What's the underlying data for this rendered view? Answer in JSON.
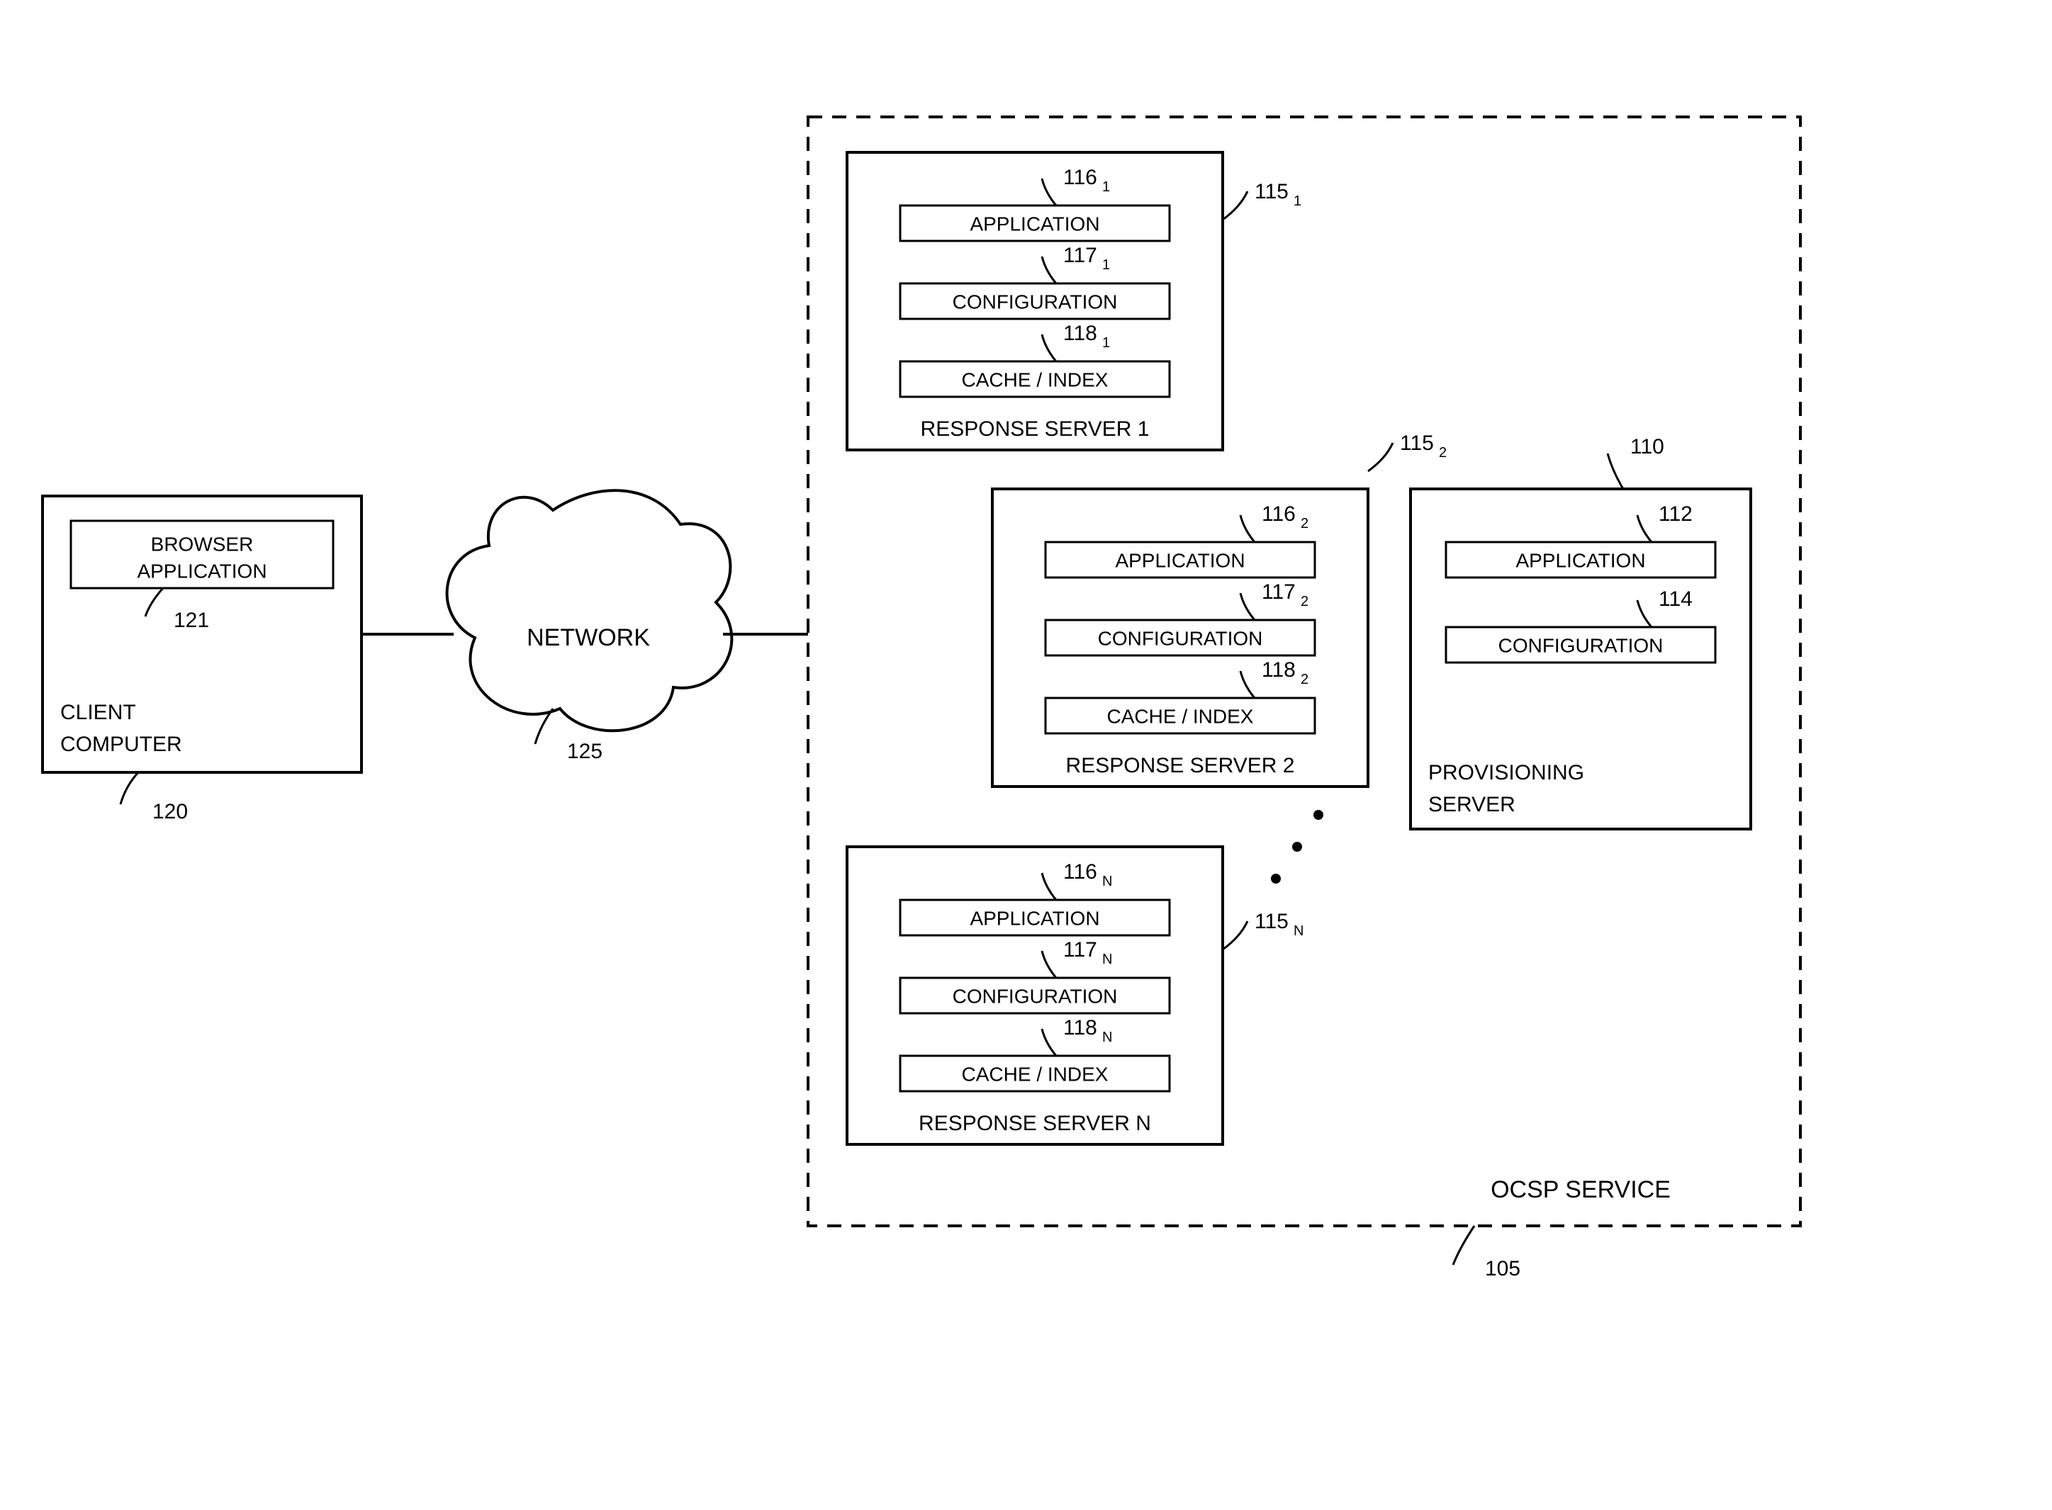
{
  "client": {
    "title_line1": "CLIENT",
    "title_line2": "COMPUTER",
    "browser_line1": "BROWSER",
    "browser_line2": "APPLICATION",
    "ref_client": "120",
    "ref_browser": "121"
  },
  "network": {
    "label": "NETWORK",
    "ref": "125"
  },
  "service": {
    "label": "OCSP SERVICE",
    "ref": "105"
  },
  "prov": {
    "title_line1": "PROVISIONING",
    "title_line2": "SERVER",
    "app": "APPLICATION",
    "cfg": "CONFIGURATION",
    "ref_box": "110",
    "ref_app": "112",
    "ref_cfg": "114"
  },
  "rs1": {
    "title": "RESPONSE SERVER 1",
    "app": "APPLICATION",
    "cfg": "CONFIGURATION",
    "cache": "CACHE / INDEX",
    "ref_box": "115",
    "ref_box_sub": "1",
    "ref_app": "116",
    "ref_app_sub": "1",
    "ref_cfg": "117",
    "ref_cfg_sub": "1",
    "ref_cache": "118",
    "ref_cache_sub": "1"
  },
  "rs2": {
    "title": "RESPONSE SERVER 2",
    "app": "APPLICATION",
    "cfg": "CONFIGURATION",
    "cache": "CACHE / INDEX",
    "ref_box": "115",
    "ref_box_sub": "2",
    "ref_app": "116",
    "ref_app_sub": "2",
    "ref_cfg": "117",
    "ref_cfg_sub": "2",
    "ref_cache": "118",
    "ref_cache_sub": "2"
  },
  "rsn": {
    "title": "RESPONSE SERVER N",
    "app": "APPLICATION",
    "cfg": "CONFIGURATION",
    "cache": "CACHE / INDEX",
    "ref_box": "115",
    "ref_box_sub": "N",
    "ref_app": "116",
    "ref_app_sub": "N",
    "ref_cfg": "117",
    "ref_cfg_sub": "N",
    "ref_cache": "118",
    "ref_cache_sub": "N"
  }
}
